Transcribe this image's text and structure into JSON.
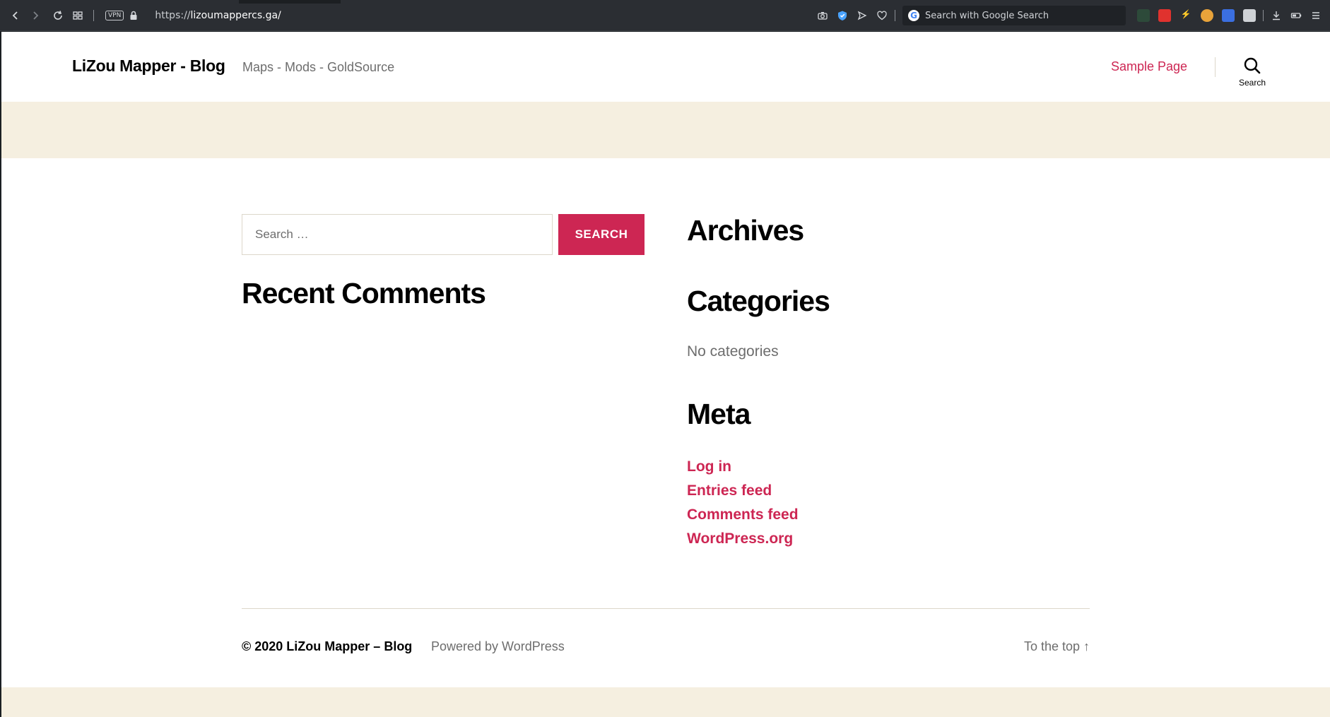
{
  "browser": {
    "url_prefix": "https://",
    "url_host": "lizoumappercs.ga/",
    "vpn_label": "VPN",
    "search_placeholder": "Search with Google Search"
  },
  "header": {
    "site_title": "LiZou Mapper - Blog",
    "tagline": "Maps - Mods - GoldSource",
    "nav": [
      {
        "label": "Sample Page"
      }
    ],
    "search_toggle_label": "Search"
  },
  "widgets": {
    "search": {
      "placeholder": "Search …",
      "button_label": "SEARCH"
    },
    "recent_comments_title": "Recent Comments",
    "archives_title": "Archives",
    "categories_title": "Categories",
    "categories_empty": "No categories",
    "meta_title": "Meta",
    "meta_links": [
      {
        "label": "Log in"
      },
      {
        "label": "Entries feed"
      },
      {
        "label": "Comments feed"
      },
      {
        "label": "WordPress.org"
      }
    ]
  },
  "footer": {
    "copyright": "© 2020 LiZou Mapper – Blog",
    "powered_by": "Powered by WordPress",
    "to_top": "To the top ↑"
  },
  "colors": {
    "accent": "#cd2653",
    "band": "#f5efe0",
    "muted_text": "#6d6d6d"
  }
}
